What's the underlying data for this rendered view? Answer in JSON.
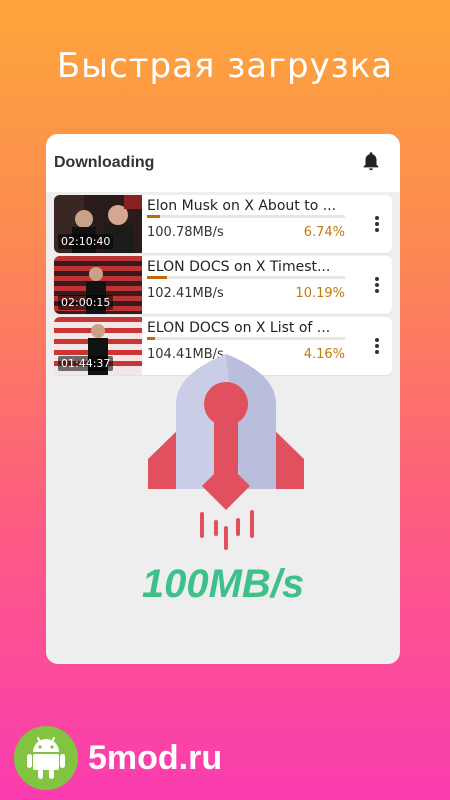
{
  "headline": "Быстрая загрузка",
  "card": {
    "title": "Downloading",
    "bell_icon": "bell-icon",
    "items": [
      {
        "title": "Elon Musk on X About to ...",
        "duration": "02:10:40",
        "speed": "100.78MB/s",
        "percent": "6.74%",
        "progress": 0.0674
      },
      {
        "title": "ELON DOCS on X Timest...",
        "duration": "02:00:15",
        "speed": "102.41MB/s",
        "percent": "10.19%",
        "progress": 0.1019
      },
      {
        "title": "ELON DOCS on X List of ...",
        "duration": "01:44:37",
        "speed": "104.41MB/s",
        "percent": "4.16%",
        "progress": 0.0416
      }
    ],
    "menu_icon": "more-vert-icon"
  },
  "promo": {
    "speed_text": "100MB/s",
    "rocket_icon": "rocket-icon"
  },
  "brand": {
    "name": "5mod.ru",
    "icon": "android-icon"
  },
  "colors": {
    "accent_green": "#3DC08A",
    "progress": "#C06A0A",
    "percent": "#C07A0A",
    "android_green": "#82C341"
  }
}
